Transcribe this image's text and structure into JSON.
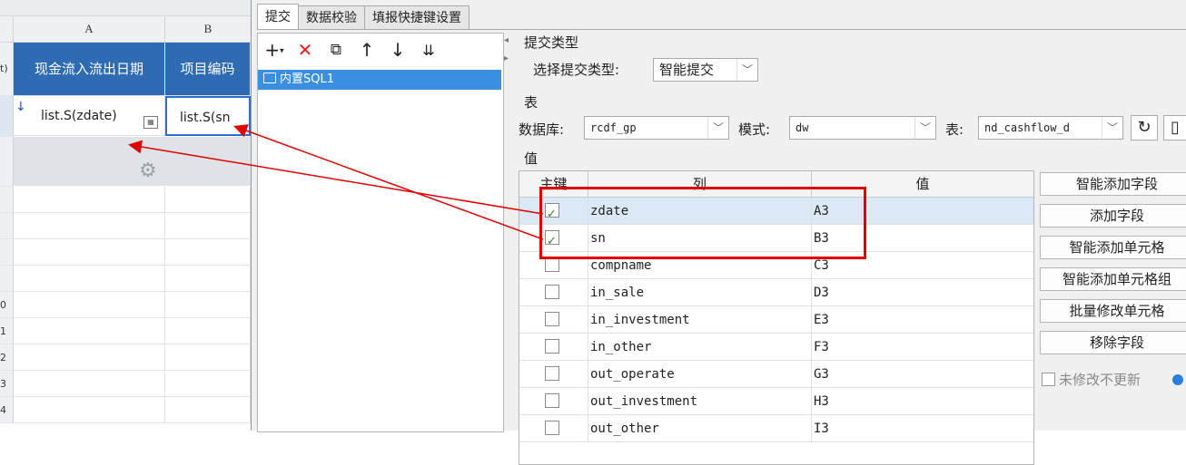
{
  "sheet": {
    "columns": [
      "A",
      "B"
    ],
    "row_header_partial": "t)",
    "header_cells": [
      "现金流入流出日期",
      "项目编码"
    ],
    "formula_cells": [
      "list.S(zdate)",
      "list.S(sn"
    ],
    "row_numbers": [
      "0",
      "1",
      "2",
      "3",
      "4"
    ]
  },
  "tabs": [
    "提交",
    "数据校验",
    "填报快捷键设置"
  ],
  "toolbar_icons": [
    "add-icon",
    "delete-icon",
    "copy-icon",
    "move-up-icon",
    "move-down-icon",
    "sort-icon"
  ],
  "submit_list": [
    "内置SQL1"
  ],
  "submit_type": {
    "section_label": "提交类型",
    "select_label": "选择提交类型:",
    "value": "智能提交"
  },
  "table_section": {
    "label": "表",
    "database_label": "数据库:",
    "database_value": "rcdf_gp",
    "schema_label": "模式:",
    "schema_value": "dw",
    "table_label": "表:",
    "table_value": "nd_cashflow_d"
  },
  "value_section": {
    "label": "值",
    "headers": [
      "主键",
      "列",
      "值"
    ],
    "rows": [
      {
        "key": true,
        "column": "zdate",
        "value": "A3"
      },
      {
        "key": true,
        "column": "sn",
        "value": "B3"
      },
      {
        "key": false,
        "column": "compname",
        "value": "C3"
      },
      {
        "key": false,
        "column": "in_sale",
        "value": "D3"
      },
      {
        "key": false,
        "column": "in_investment",
        "value": "E3"
      },
      {
        "key": false,
        "column": "in_other",
        "value": "F3"
      },
      {
        "key": false,
        "column": "out_operate",
        "value": "G3"
      },
      {
        "key": false,
        "column": "out_investment",
        "value": "H3"
      },
      {
        "key": false,
        "column": "out_other",
        "value": "I3"
      }
    ]
  },
  "side_buttons": [
    "智能添加字段",
    "添加字段",
    "智能添加单元格",
    "智能添加单元格组",
    "批量修改单元格",
    "移除字段"
  ],
  "no_change_label": "未修改不更新",
  "colors": {
    "accent": "#3b8fe0",
    "header_blue": "#2e6bb3",
    "highlight": "#e00000"
  }
}
